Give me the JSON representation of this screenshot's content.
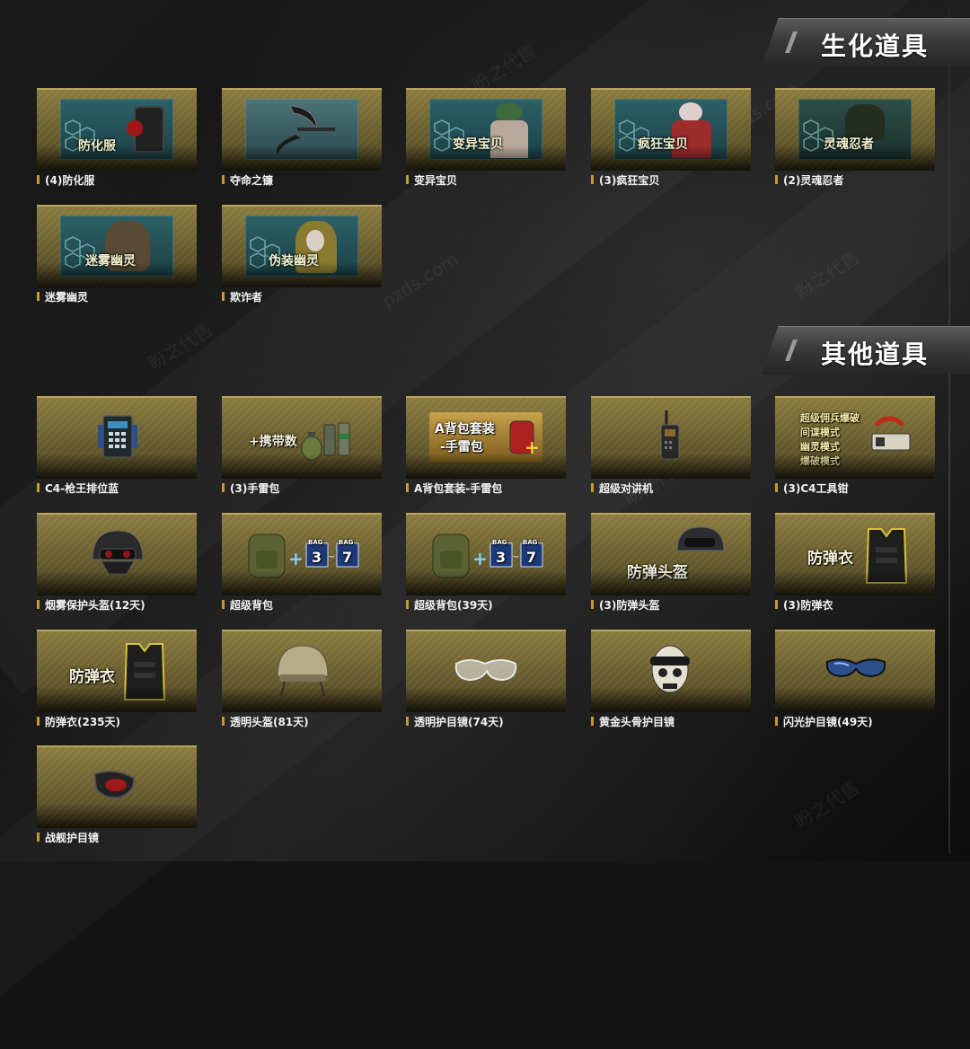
{
  "sections": [
    {
      "title": "生化道具",
      "items": [
        {
          "label": "(4)防化服",
          "art_text": "防化服",
          "icon": "hazmat-suit-icon"
        },
        {
          "label": "夺命之镰",
          "art_text": "",
          "icon": "scythe-icon"
        },
        {
          "label": "变异宝贝",
          "art_text": "变异宝贝",
          "icon": "mutant-baby-icon"
        },
        {
          "label": "(3)疯狂宝贝",
          "art_text": "疯狂宝贝",
          "icon": "crazy-baby-icon"
        },
        {
          "label": "(2)灵魂忍者",
          "art_text": "灵魂忍者",
          "icon": "soul-ninja-icon"
        },
        {
          "label": "迷雾幽灵",
          "art_text": "迷雾幽灵",
          "icon": "mist-ghost-icon"
        },
        {
          "label": "欺诈者",
          "art_text": "伪装幽灵",
          "icon": "disguise-ghost-icon"
        }
      ]
    },
    {
      "title": "其他道具",
      "items": [
        {
          "label": "C4-枪王排位蓝",
          "art_text": "",
          "icon": "c4-bomb-icon"
        },
        {
          "label": "(3)手雷包",
          "art_text": "+携带数",
          "icon": "grenade-pack-icon"
        },
        {
          "label": "A背包套装-手雷包",
          "art_text": "A背包套装",
          "art_text_2": "-手雷包",
          "icon": "backpack-set-icon"
        },
        {
          "label": "超级对讲机",
          "art_text": "",
          "icon": "walkie-talkie-icon"
        },
        {
          "label": "(3)C4工具钳",
          "art_lines": [
            "超级佣兵爆破",
            "间谍模式",
            "幽灵模式",
            "爆破模式"
          ],
          "icon": "c4-pliers-icon"
        },
        {
          "label": "烟雾保护头盔(12天)",
          "art_text": "",
          "icon": "smoke-helmet-icon"
        },
        {
          "label": "超级背包",
          "bag_from": "3",
          "bag_to": "7",
          "bag_tag": "BAG",
          "icon": "super-backpack-icon"
        },
        {
          "label": "超级背包(39天)",
          "bag_from": "3",
          "bag_to": "7",
          "bag_tag": "BAG",
          "icon": "super-backpack-icon"
        },
        {
          "label": "(3)防弹头盔",
          "art_text": "防弹头盔",
          "icon": "bulletproof-helmet-icon"
        },
        {
          "label": "(3)防弹衣",
          "art_text": "防弹衣",
          "icon": "bulletproof-vest-icon"
        },
        {
          "label": "防弹衣(235天)",
          "art_text": "防弹衣",
          "icon": "bulletproof-vest-icon"
        },
        {
          "label": "透明头盔(81天)",
          "art_text": "",
          "icon": "clear-helmet-icon"
        },
        {
          "label": "透明护目镜(74天)",
          "art_text": "",
          "icon": "clear-goggles-icon"
        },
        {
          "label": "黄金头骨护目镜",
          "art_text": "",
          "icon": "golden-skull-goggles-icon"
        },
        {
          "label": "闪光护目镜(49天)",
          "art_text": "",
          "icon": "flash-goggles-icon"
        },
        {
          "label": "战舰护目镜",
          "art_text": "",
          "icon": "battleship-goggles-icon"
        }
      ]
    }
  ],
  "watermark": "盼之代售",
  "watermark_url": "pzds.com",
  "colors": {
    "tile_gold": "#8a7b3f",
    "label_bar": "#c79a2c",
    "text": "#f2f2f2"
  }
}
